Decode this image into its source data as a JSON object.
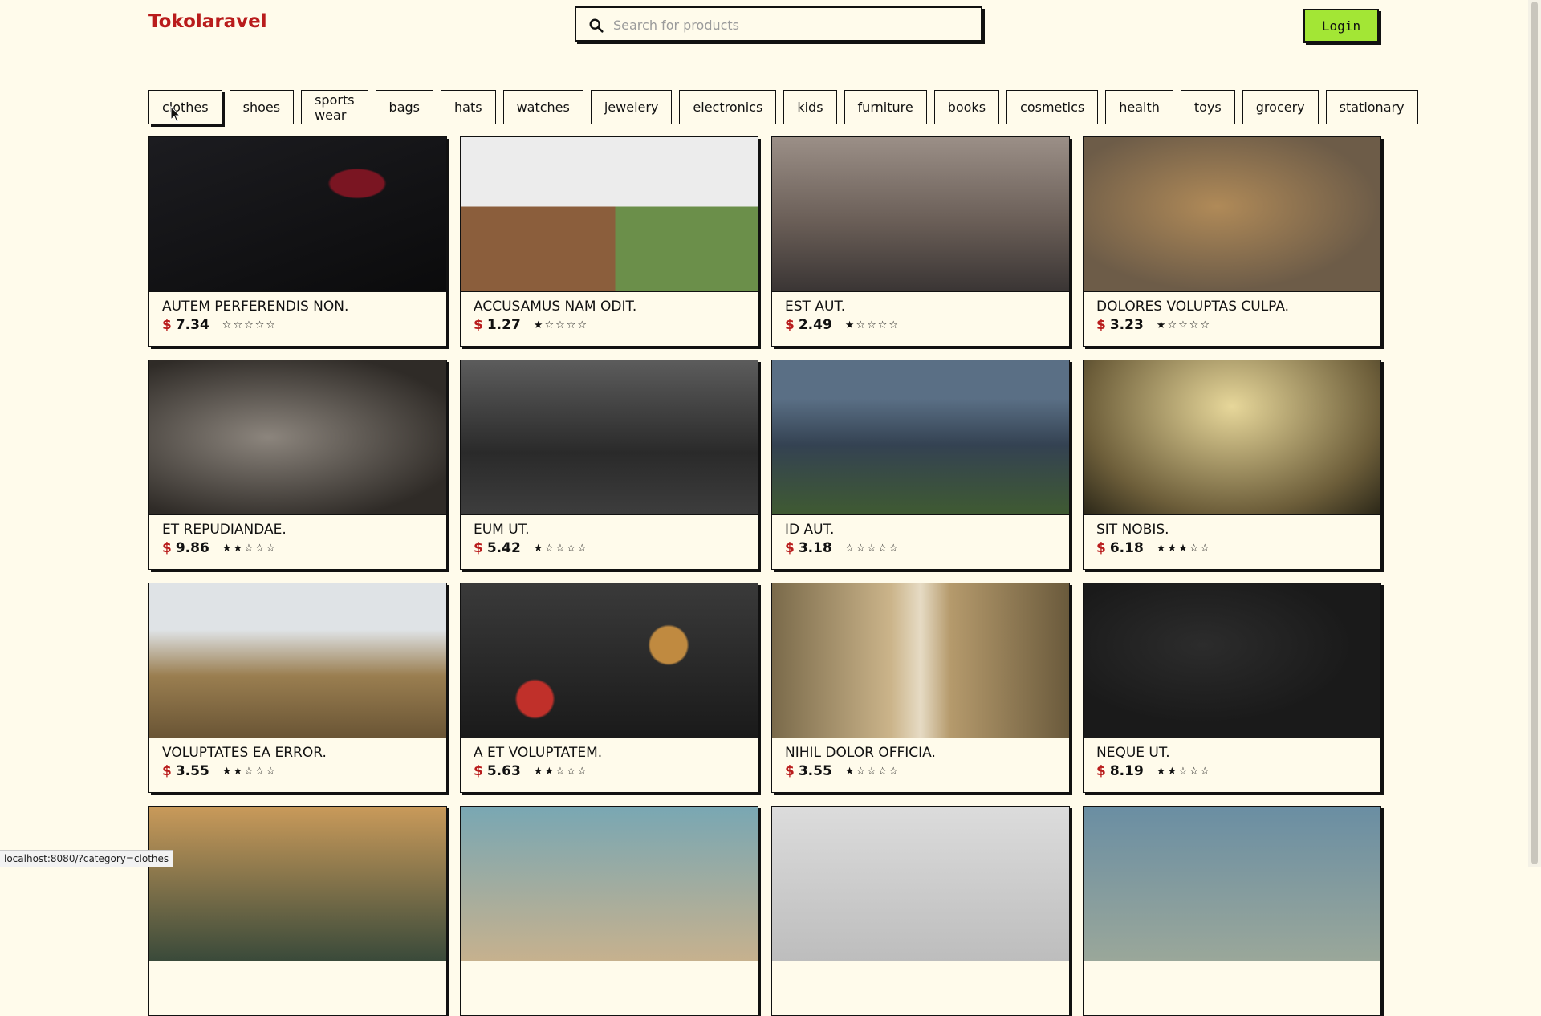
{
  "header": {
    "brand": "Tokolaravel",
    "search_placeholder": "Search for products",
    "search_value": "",
    "login_label": "Login"
  },
  "categories": [
    {
      "label": "clothes",
      "active": true
    },
    {
      "label": "shoes"
    },
    {
      "label": "sports wear"
    },
    {
      "label": "bags"
    },
    {
      "label": "hats"
    },
    {
      "label": "watches"
    },
    {
      "label": "jewelery"
    },
    {
      "label": "electronics"
    },
    {
      "label": "kids"
    },
    {
      "label": "furniture"
    },
    {
      "label": "books"
    },
    {
      "label": "cosmetics"
    },
    {
      "label": "health"
    },
    {
      "label": "toys"
    },
    {
      "label": "grocery"
    },
    {
      "label": "stationary"
    }
  ],
  "currency": "$",
  "products": [
    {
      "name": "AUTEM PERFERENDIS NON.",
      "price": "7.34",
      "rating": 0
    },
    {
      "name": "ACCUSAMUS NAM ODIT.",
      "price": "1.27",
      "rating": 1
    },
    {
      "name": "EST AUT.",
      "price": "2.49",
      "rating": 1
    },
    {
      "name": "DOLORES VOLUPTAS CULPA.",
      "price": "3.23",
      "rating": 1
    },
    {
      "name": "ET REPUDIANDAE.",
      "price": "9.86",
      "rating": 2
    },
    {
      "name": "EUM UT.",
      "price": "5.42",
      "rating": 1
    },
    {
      "name": "ID AUT.",
      "price": "3.18",
      "rating": 0
    },
    {
      "name": "SIT NOBIS.",
      "price": "6.18",
      "rating": 3
    },
    {
      "name": "VOLUPTATES EA ERROR.",
      "price": "3.55",
      "rating": 2
    },
    {
      "name": "A ET VOLUPTATEM.",
      "price": "5.63",
      "rating": 2
    },
    {
      "name": "NIHIL DOLOR OFFICIA.",
      "price": "3.55",
      "rating": 1
    },
    {
      "name": "NEQUE UT.",
      "price": "8.19",
      "rating": 2
    },
    {
      "name": "",
      "price": "",
      "rating": 0
    },
    {
      "name": "",
      "price": "",
      "rating": 0
    },
    {
      "name": "",
      "price": "",
      "rating": 0
    },
    {
      "name": "",
      "price": "",
      "rating": 0
    }
  ],
  "status_url": "localhost:8080/?category=clothes",
  "colors": {
    "brand": "#b91c1c",
    "accent": "#a3e635",
    "background": "#fffbeb"
  }
}
